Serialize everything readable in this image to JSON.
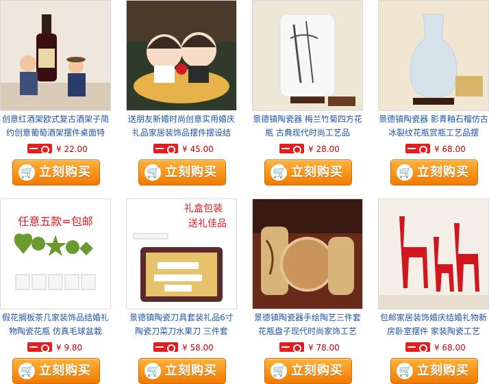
{
  "buy_label": "立刻购买",
  "products": [
    {
      "title": "创意红酒架欧式复古酒架子简约创意葡萄酒架摆件桌面特",
      "price": "¥ 22.00"
    },
    {
      "title": "送朋友新婚时尚创意实用婚庆礼品家居装饰品摆件摆设结",
      "price": "¥ 45.00"
    },
    {
      "title": "景德镇陶瓷器 梅兰竹菊四方花瓶 古典现代时尚工艺品",
      "price": "¥ 28.00"
    },
    {
      "title": "景德镇陶瓷器 影青釉石榴仿古冰裂纹花瓶赏瓶工艺品摆",
      "price": "¥ 68.00"
    },
    {
      "title": "假花搁板茶几家装饰品结婚礼物陶瓷花瓶 仿真毛球盆栽",
      "price": "¥ 9.80"
    },
    {
      "title": "景德镇陶瓷刀具套装礼品6寸陶瓷刀菜刀水果刀 三件套",
      "price": "¥ 58.00"
    },
    {
      "title": "景德镇陶瓷器手绘陶艺三件套花瓶盘子现代时尚家饰工艺",
      "price": "¥ 78.00"
    },
    {
      "title": "包邮家居装饰婚庆结婚礼物新房卧室摆件 家装陶瓷工艺",
      "price": "¥ 68.00"
    }
  ],
  "overlays": {
    "promo_text": "任意五款=包邮",
    "gift_line1": "礼盒包装",
    "gift_line2": "送礼佳品"
  }
}
